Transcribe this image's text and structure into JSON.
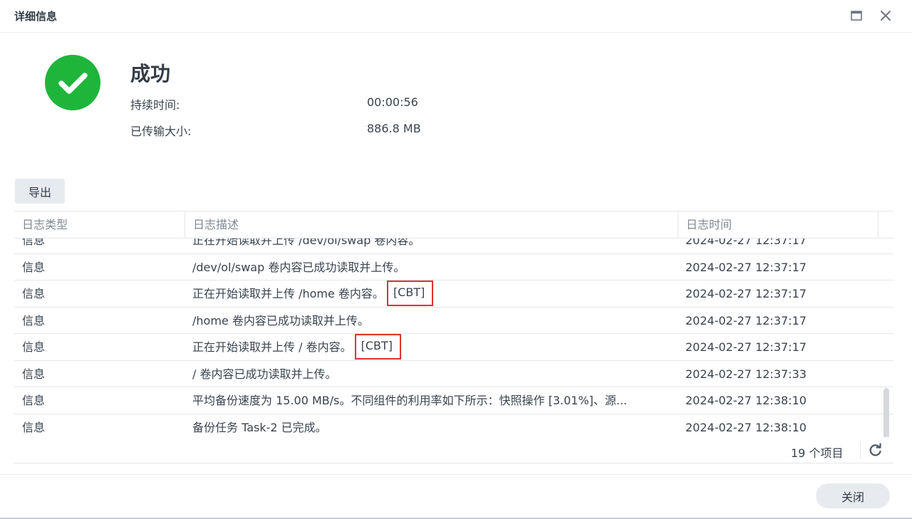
{
  "window": {
    "title": "详细信息",
    "icons": {
      "maximize": "maximize-icon",
      "close": "close-icon"
    }
  },
  "status": {
    "icon": "check-circle-icon",
    "title": "成功",
    "color": "#1fb53b",
    "duration_label": "持续时间:",
    "duration_value": "00:00:56",
    "transferred_label": "已传输大小:",
    "transferred_value": "886.8 MB"
  },
  "toolbar": {
    "export_label": "导出"
  },
  "log_table": {
    "headers": [
      "日志类型",
      "日志描述",
      "日志时间"
    ],
    "partial_top_row": {
      "type": "信息",
      "desc": "正在开始读取并上传 /dev/ol/swap 卷内容。",
      "time": "2024-02-27 12:37:17"
    },
    "rows": [
      {
        "type": "信息",
        "desc": "/dev/ol/swap 卷内容已成功读取并上传。",
        "desc_tag": "",
        "time": "2024-02-27 12:37:17"
      },
      {
        "type": "信息",
        "desc": "正在开始读取并上传 /home 卷内容。",
        "desc_tag": "[CBT]",
        "time": "2024-02-27 12:37:17"
      },
      {
        "type": "信息",
        "desc": "/home 卷内容已成功读取并上传。",
        "desc_tag": "",
        "time": "2024-02-27 12:37:17"
      },
      {
        "type": "信息",
        "desc": "正在开始读取并上传 / 卷内容。",
        "desc_tag": "[CBT]",
        "time": "2024-02-27 12:37:17"
      },
      {
        "type": "信息",
        "desc": "/ 卷内容已成功读取并上传。",
        "desc_tag": "",
        "time": "2024-02-27 12:37:33"
      },
      {
        "type": "信息",
        "desc": "平均备份速度为 15.00 MB/s。不同组件的利用率如下所示：快照操作 [3.01%]、源...",
        "desc_tag": "",
        "time": "2024-02-27 12:38:10"
      },
      {
        "type": "信息",
        "desc": "备份任务 Task-2 已完成。",
        "desc_tag": "",
        "time": "2024-02-27 12:38:10"
      }
    ],
    "highlight_color": "#e0322f",
    "item_count": "19 个项目",
    "refresh_icon": "refresh-icon"
  },
  "footer": {
    "close_label": "关闭"
  }
}
